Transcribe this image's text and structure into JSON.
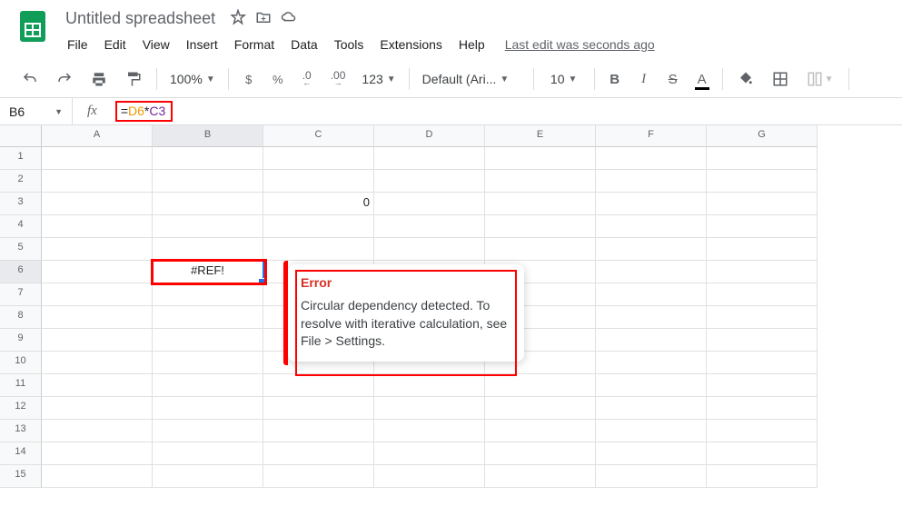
{
  "doc": {
    "title": "Untitled spreadsheet"
  },
  "menu": {
    "file": "File",
    "edit": "Edit",
    "view": "View",
    "insert": "Insert",
    "format": "Format",
    "data": "Data",
    "tools": "Tools",
    "extensions": "Extensions",
    "help": "Help",
    "last_edit": "Last edit was seconds ago"
  },
  "toolbar": {
    "zoom": "100%",
    "currency": "$",
    "percent": "%",
    "dec_less": ".0",
    "dec_more": ".00",
    "num_fmt": "123",
    "font": "Default (Ari...",
    "size": "10"
  },
  "formula": {
    "cell_ref": "B6",
    "fx": "fx",
    "eq": "=",
    "ref1": "D6",
    "op": "*",
    "ref2": "C3"
  },
  "columns": [
    "A",
    "B",
    "C",
    "D",
    "E",
    "F",
    "G"
  ],
  "rows": [
    "1",
    "2",
    "3",
    "4",
    "5",
    "6",
    "7",
    "8",
    "9",
    "10",
    "11",
    "12",
    "13",
    "14",
    "15"
  ],
  "cells": {
    "C3": "0",
    "B6": "#REF!"
  },
  "tooltip": {
    "title": "Error",
    "body": "Circular dependency detected. To resolve with iterative calculation, see File > Settings."
  }
}
